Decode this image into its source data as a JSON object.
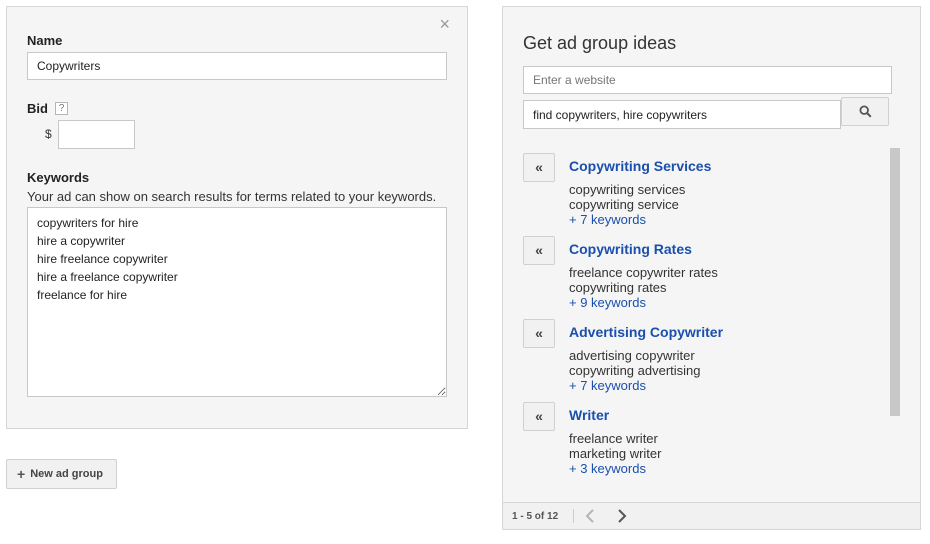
{
  "ad_group": {
    "name_label": "Name",
    "name_value": "Copywriters",
    "bid_label": "Bid",
    "bid_help": "?",
    "currency": "$",
    "bid_value": "",
    "keywords_label": "Keywords",
    "keywords_description": "Your ad can show on search results for terms related to your keywords.",
    "keywords_value": "copywriters for hire\nhire a copywriter\nhire freelance copywriter\nhire a freelance copywriter\nfreelance for hire",
    "close": "×"
  },
  "new_ad_group_button": "New ad group",
  "ideas": {
    "title": "Get ad group ideas",
    "website_placeholder": "Enter a website",
    "website_value": "",
    "search_value": "find copywriters, hire copywriters",
    "add_symbol": "«",
    "items": [
      {
        "title": "Copywriting Services",
        "keywords": [
          "copywriting services",
          "copywriting service"
        ],
        "more": "+ 7 keywords"
      },
      {
        "title": "Copywriting Rates",
        "keywords": [
          "freelance copywriter rates",
          "copywriting rates"
        ],
        "more": "+ 9 keywords"
      },
      {
        "title": "Advertising Copywriter",
        "keywords": [
          "advertising copywriter",
          "copywriting advertising"
        ],
        "more": "+ 7 keywords"
      },
      {
        "title": "Writer",
        "keywords": [
          "freelance writer",
          "marketing writer"
        ],
        "more": "+ 3 keywords"
      }
    ],
    "pagination": "1 - 5 of 12"
  },
  "icons": {
    "close": "close-icon",
    "help": "help-icon",
    "plus": "plus-icon",
    "search": "search-icon",
    "add": "add-arrow-icon",
    "prev": "chevron-left-icon",
    "next": "chevron-right-icon"
  },
  "colors": {
    "link": "#1a4fae",
    "panel_bg": "#f5f5f5",
    "border": "#d6d6d6"
  }
}
